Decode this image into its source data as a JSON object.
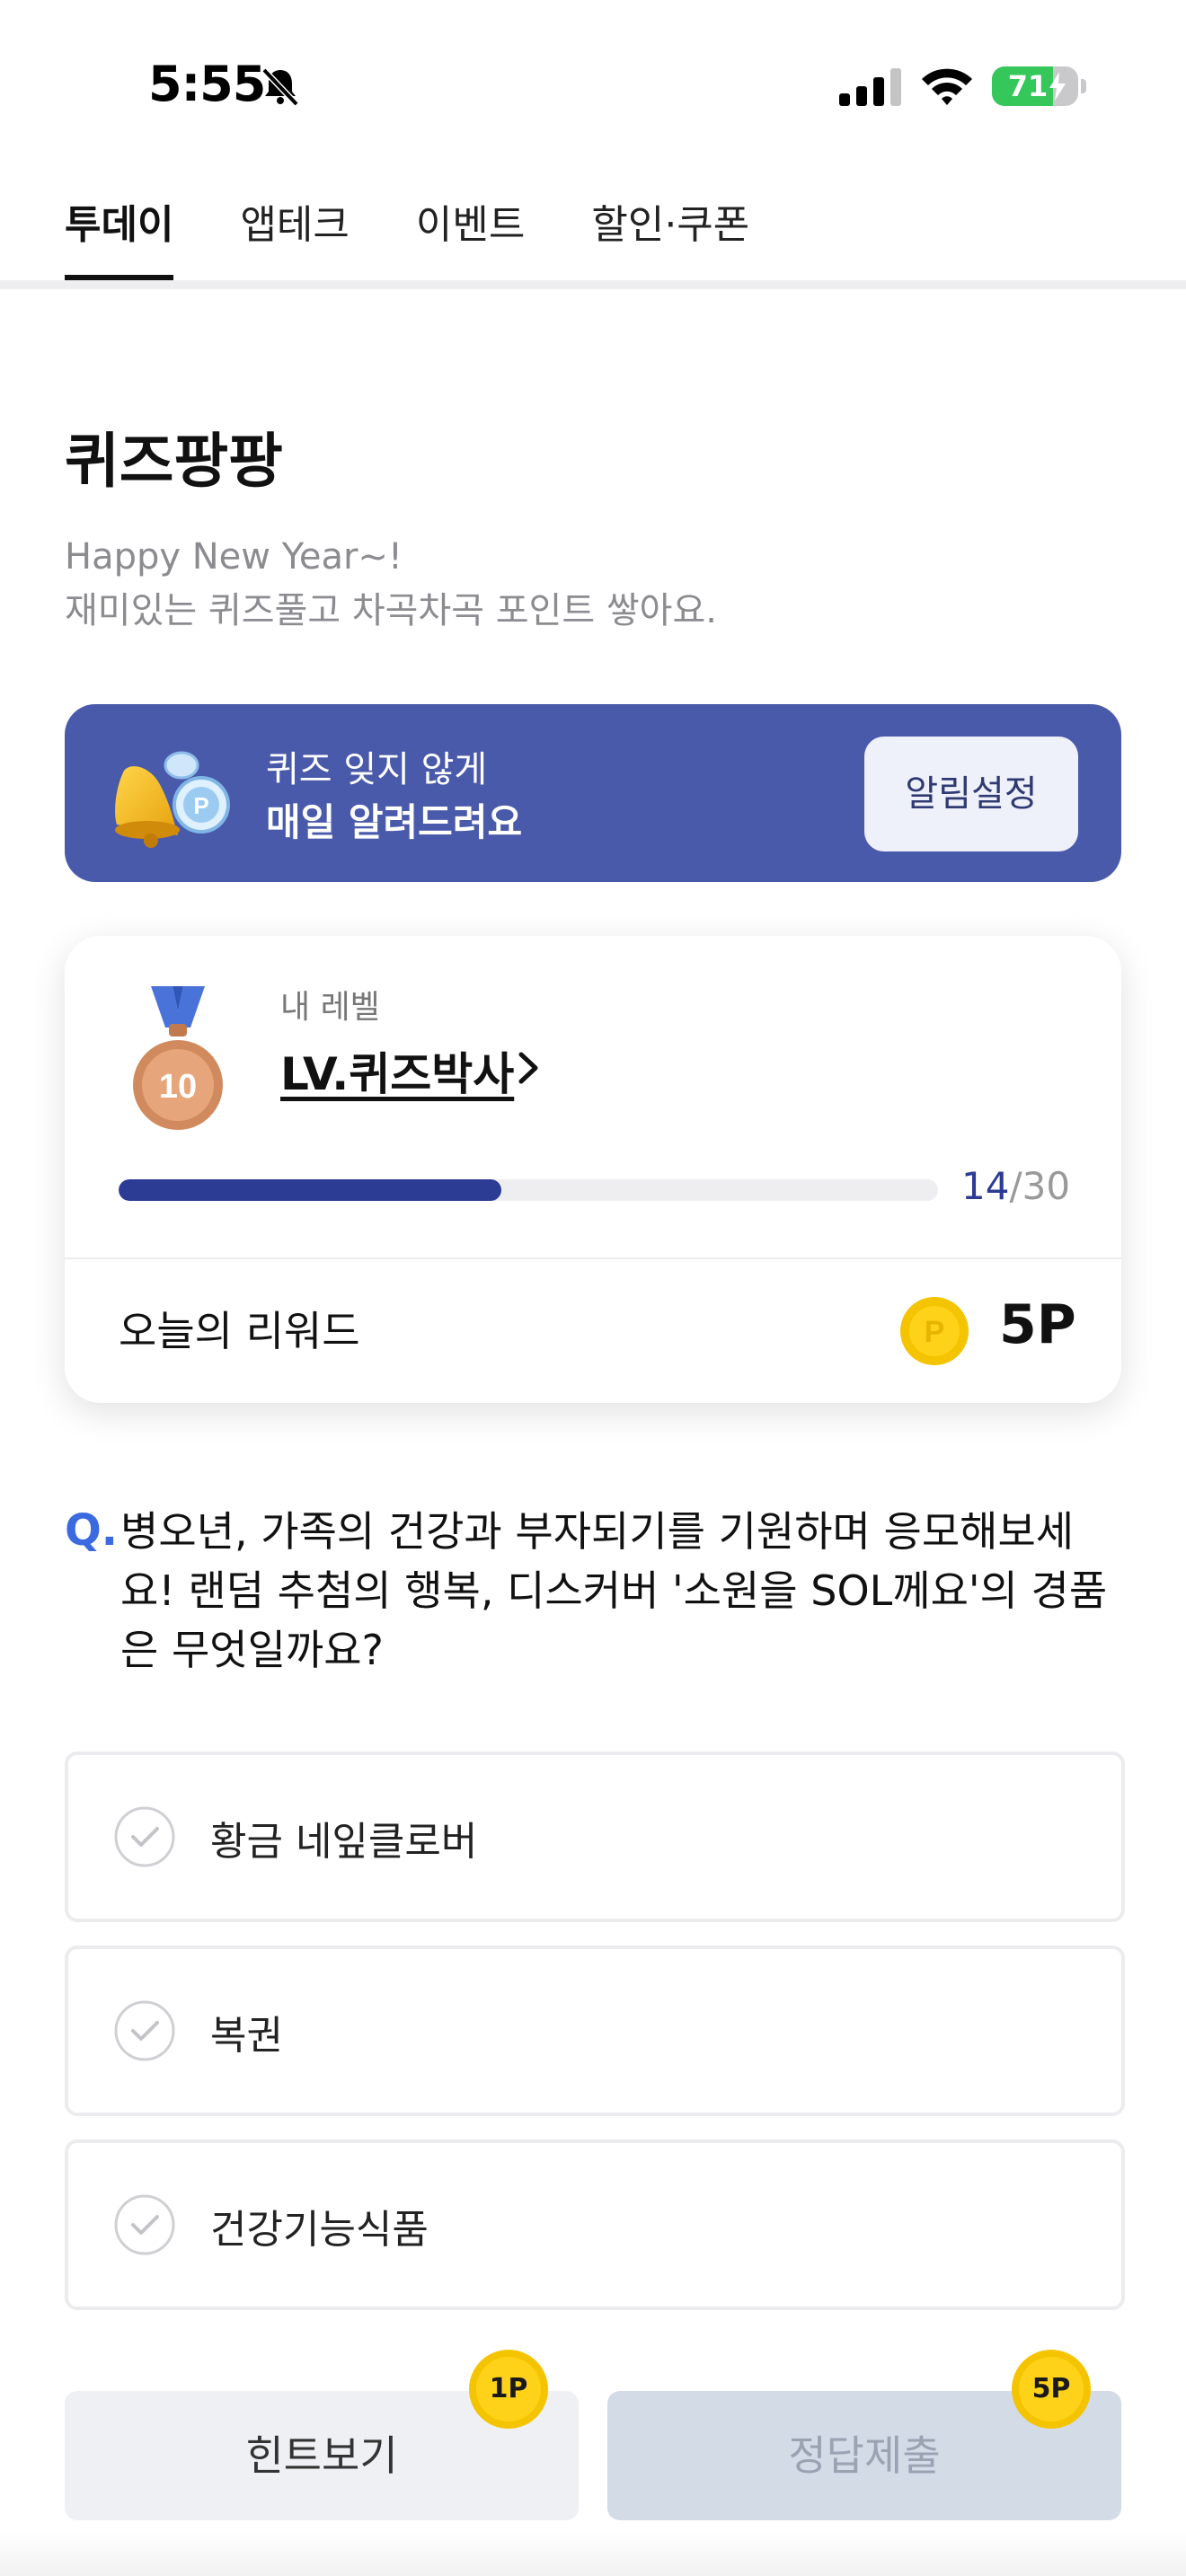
{
  "status_bar": {
    "time": "5:55",
    "battery": "71",
    "battery_level": 0.71
  },
  "tabs": [
    {
      "label": "투데이",
      "active": true
    },
    {
      "label": "앱테크",
      "active": false
    },
    {
      "label": "이벤트",
      "active": false
    },
    {
      "label": "할인·쿠폰",
      "active": false
    }
  ],
  "page": {
    "title": "퀴즈팡팡",
    "subtitle_line1": "Happy New Year~!",
    "subtitle_line2": "재미있는 퀴즈풀고 차곡차곡 포인트 쌓아요."
  },
  "banner": {
    "line1": "퀴즈 잊지 않게",
    "line2": "매일 알려드려요",
    "button_label": "알림설정",
    "background_color": "#4a5aab"
  },
  "level_card": {
    "caption": "내 레벨",
    "level_name": "LV.퀴즈박사",
    "medal_number": "10",
    "progress_current": "14",
    "progress_total": "/30",
    "progress_fraction": 0.4667,
    "reward_label": "오늘의 리워드",
    "reward_value": "5P"
  },
  "quiz": {
    "q_mark": "Q.",
    "question": "병오년, 가족의 건강과 부자되기를 기원하며 응모해보세요! 랜덤 추첨의 행복, 디스커버 '소원을 SOL께요'의 경품은 무엇일까요?",
    "options": [
      {
        "label": "황금 네잎클로버"
      },
      {
        "label": "복권"
      },
      {
        "label": "건강기능식품"
      }
    ]
  },
  "actions": {
    "hint_label": "힌트보기",
    "hint_cost": "1P",
    "submit_label": "정답제출",
    "submit_reward": "5P"
  },
  "colors": {
    "accent": "#2c3b94",
    "question_mark": "#3b6ae0",
    "coin": "#f5c400"
  }
}
